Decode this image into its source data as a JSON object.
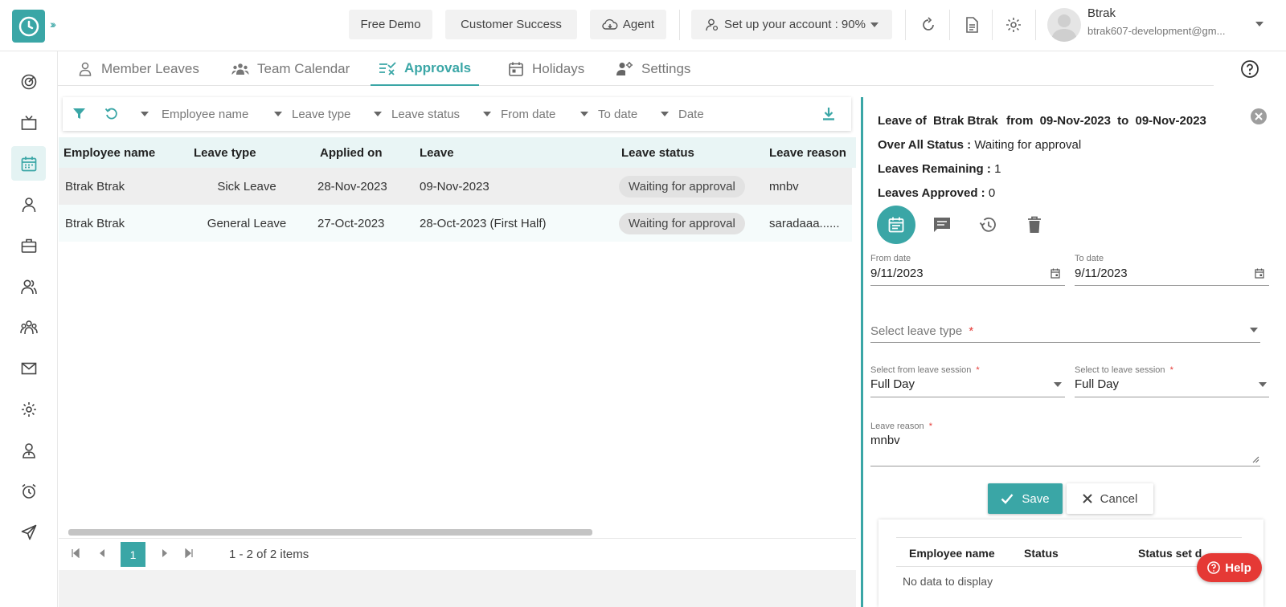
{
  "topbar": {
    "free_demo": "Free Demo",
    "customer_success": "Customer Success",
    "agent": "Agent",
    "setup": "Set up your account : 90%",
    "user_name": "Btrak",
    "user_email": "btrak607-development@gm..."
  },
  "tabs": [
    {
      "label": "Member Leaves"
    },
    {
      "label": "Team Calendar"
    },
    {
      "label": "Approvals"
    },
    {
      "label": "Holidays"
    },
    {
      "label": "Settings"
    }
  ],
  "filters": {
    "employee_name": "Employee name",
    "leave_type": "Leave type",
    "leave_status": "Leave status",
    "from_date": "From date",
    "to_date": "To date",
    "date": "Date"
  },
  "grid": {
    "headers": [
      "Employee name",
      "Leave type",
      "Applied on",
      "Leave",
      "Leave status",
      "Leave reason"
    ],
    "rows": [
      {
        "employee": "Btrak Btrak",
        "type": "Sick Leave",
        "applied": "28-Nov-2023",
        "leave": "09-Nov-2023",
        "status": "Waiting for approval",
        "reason": "mnbv"
      },
      {
        "employee": "Btrak Btrak",
        "type": "General Leave",
        "applied": "27-Oct-2023",
        "leave": "28-Oct-2023 (First Half)",
        "status": "Waiting for approval",
        "reason": "saradaaa......"
      }
    ]
  },
  "pager": {
    "page": "1",
    "summary": "1 - 2 of 2 items"
  },
  "panel": {
    "leave_of_label": "Leave of",
    "leave_of_name": "Btrak Btrak",
    "from_word": "from",
    "from_date": "09-Nov-2023",
    "to_word": "to",
    "to_date": "09-Nov-2023",
    "overall_label": "Over All Status :",
    "overall_value": "Waiting for approval",
    "remaining_label": "Leaves Remaining :",
    "remaining_value": "1",
    "approved_label": "Leaves Approved :",
    "approved_value": "0",
    "form": {
      "from_date_label": "From date",
      "from_date_value": "9/11/2023",
      "to_date_label": "To date",
      "to_date_value": "9/11/2023",
      "leave_type_placeholder": "Select leave type",
      "from_session_label": "Select from leave session",
      "from_session_value": "Full Day",
      "to_session_label": "Select to leave session",
      "to_session_value": "Full Day",
      "reason_label": "Leave reason",
      "reason_value": "mnbv",
      "required_mark": "*"
    },
    "save": "Save",
    "cancel": "Cancel",
    "subgrid": {
      "headers": [
        "Employee name",
        "Status",
        "Status set d"
      ],
      "empty": "No data to display"
    }
  },
  "help": "Help",
  "colors": {
    "accent": "#3aa6a6",
    "help": "#e53935"
  }
}
